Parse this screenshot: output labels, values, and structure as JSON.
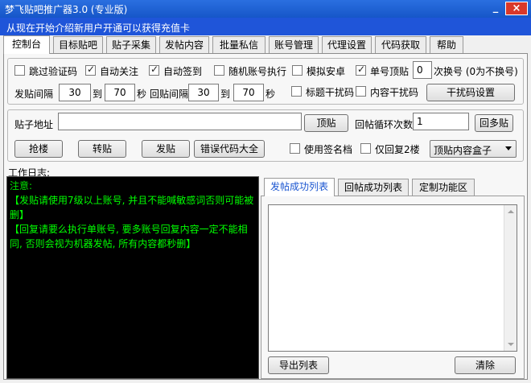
{
  "window": {
    "title": "梦飞贴吧推广器3.0 (专业版)",
    "minimize": "_",
    "close": "×"
  },
  "notice": "从现在开始介绍新用户开通可以获得充值卡",
  "tabs": [
    "控制台",
    "目标贴吧",
    "贴子采集",
    "发帖内容",
    "批量私信",
    "账号管理",
    "代理设置",
    "代码获取",
    "帮助"
  ],
  "settings": {
    "skip_captcha": "跳过验证码",
    "auto_follow": "自动关注",
    "auto_signin": "自动签到",
    "random_account": "随机账号执行",
    "simulate_android": "模拟安卓",
    "single_account_top": "单号顶贴",
    "switch_count_value": "0",
    "switch_count_label": "次换号 (0为不换号)",
    "post_interval_label": "发贴间隔",
    "post_interval_from": "30",
    "to1": "到",
    "post_interval_to": "70",
    "sec1": "秒",
    "reply_interval_label": "回贴间隔",
    "reply_interval_from": "30",
    "to2": "到",
    "reply_interval_to": "70",
    "sec2": "秒",
    "title_interference": "标题干扰码",
    "content_interference": "内容干扰码",
    "interference_settings": "干扰码设置"
  },
  "post": {
    "address_label": "贴子地址",
    "address_value": "",
    "top_button": "顶贴",
    "reply_loop_label": "回帖循环次数",
    "reply_loop_value": "1",
    "multi_reply_button": "回多贴",
    "grab_floor": "抢楼",
    "repost": "转贴",
    "post": "发贴",
    "error_codes": "错误代码大全",
    "use_signature": "使用签名档",
    "reply_2nd_only": "仅回复2楼",
    "content_box_select": "顶贴内容盒子"
  },
  "log": {
    "label": "工作日志:",
    "note_title": "注意:",
    "line1": "【发贴请使用7级以上账号, 并且不能喊敏感词否则可能被删】",
    "line2": "【回复请要么执行单账号, 要多账号回复内容一定不能相同, 否则会视为机器发帖, 所有内容都秒删】"
  },
  "right_tabs": [
    "发帖成功列表",
    "回帖成功列表",
    "定制功能区"
  ],
  "list": {
    "export_button": "导出列表",
    "clear_button": "清除"
  },
  "colors": {
    "titlebar": "#1656c8",
    "notice_bg": "#1f55d9",
    "log_bg": "#000000",
    "log_text": "#00ff00",
    "active_tab_text": "#1a55d0"
  }
}
